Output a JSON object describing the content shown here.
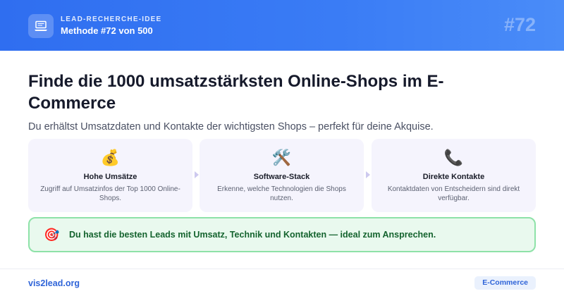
{
  "header": {
    "icon": "laptop-icon",
    "kicker": "LEAD-RECHERCHE-IDEE",
    "subtitle": "Methode #72 von 500",
    "number": "#72"
  },
  "main": {
    "title": "Finde die 1000 umsatzstärksten Online-Shops im E-Commerce",
    "subtitle": "Du erhältst Umsatzdaten und Kontakte der wichtigsten Shops – perfekt für deine Akquise."
  },
  "cards": [
    {
      "emoji": "💰",
      "icon": "money-bag-icon",
      "title": "Hohe Umsätze",
      "desc": "Zugriff auf Umsatzinfos der Top 1000 Online-Shops."
    },
    {
      "emoji": "🛠️",
      "icon": "tools-icon",
      "title": "Software-Stack",
      "desc": "Erkenne, welche Technologien die Shops nutzen."
    },
    {
      "emoji": "📞",
      "icon": "phone-icon",
      "title": "Direkte Kontakte",
      "desc": "Kontaktdaten von Entscheidern sind direkt verfügbar."
    }
  ],
  "callout": {
    "emoji": "🎯",
    "icon": "target-icon",
    "text": "Du hast die besten Leads mit Umsatz, Technik und Kontakten — ideal zum Ansprechen."
  },
  "footer": {
    "brand": "vis2lead.org",
    "tag": "E-Commerce"
  },
  "colors": {
    "header_blue": "#2f6ef0",
    "card_bg": "#f5f4fd",
    "callout_bg": "#e9f9ee",
    "callout_border": "#8ee2a8",
    "callout_text": "#14632e",
    "brand_blue": "#2f64d8"
  }
}
